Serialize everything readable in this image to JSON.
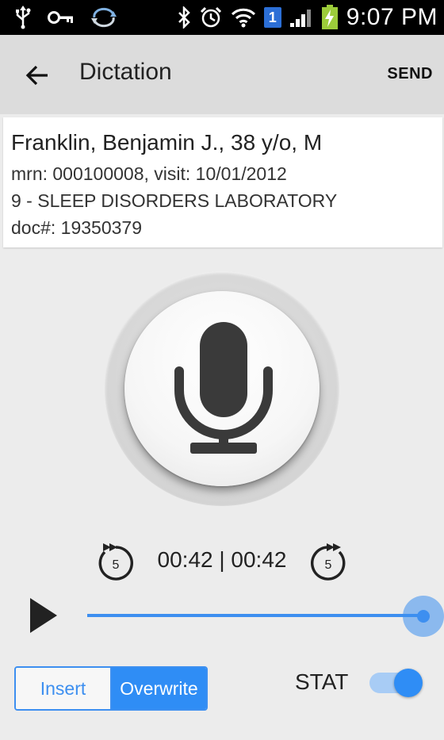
{
  "status_bar": {
    "time": "9:07 PM",
    "notification_count": "1",
    "icons": [
      "usb-icon",
      "key-icon",
      "sync-icon",
      "bluetooth-icon",
      "alarm-icon",
      "wifi-icon",
      "signal-icon",
      "battery-charging-icon"
    ]
  },
  "app_bar": {
    "title": "Dictation",
    "send_label": "SEND",
    "back_icon": "arrow-left-icon"
  },
  "patient": {
    "name_line": "Franklin, Benjamin J., 38 y/o, M",
    "mrn_line": "mrn: 000100008, visit: 10/01/2012",
    "department_line": "9 - SLEEP DISORDERS LABORATORY",
    "doc_line": "doc#: 19350379"
  },
  "recorder": {
    "mic_icon": "microphone-icon",
    "rewind_seconds": "5",
    "forward_seconds": "5",
    "time_display": "00:42 | 00:42",
    "playback_progress": 1.0
  },
  "mode": {
    "options": [
      "Insert",
      "Overwrite"
    ],
    "selected": "Overwrite"
  },
  "stat": {
    "label": "STAT",
    "enabled": true
  },
  "colors": {
    "accent": "#3d8ff0",
    "status_bar_bg": "#000000",
    "app_bar_bg": "#dcdcdc",
    "page_bg": "#ececec"
  }
}
